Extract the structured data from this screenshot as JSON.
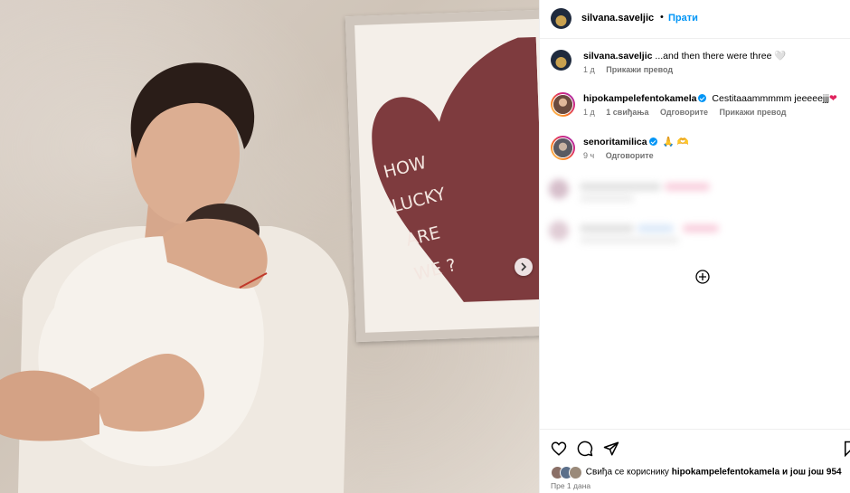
{
  "post": {
    "username": "silvana.saveljic",
    "separator": "•",
    "follow_label": "Прати"
  },
  "photo": {
    "sign_text": [
      "HOW",
      "LUCKY",
      "ARE",
      "WE ?"
    ],
    "colors": {
      "heart": "#7e3b3e",
      "frame": "#cfc6bd",
      "shirt": "#f2ede6"
    }
  },
  "comments": [
    {
      "username": "silvana.saveljic",
      "text": "...and then there were three",
      "emoji": "🤍",
      "time": "1 д",
      "actions": [
        "Прикажи превод"
      ]
    },
    {
      "username": "hipokampelefentokamela",
      "verified": true,
      "text": "Cestitaaammmmm jeeeeejjj",
      "emoji": "❤",
      "time": "1 д",
      "likes": "1 свиђања",
      "actions": [
        "Одговорите",
        "Прикажи превод"
      ]
    },
    {
      "username": "senoritamilica",
      "verified": true,
      "text": "",
      "emoji": "🙏 🫶",
      "time": "9 ч",
      "actions": [
        "Одговорите"
      ]
    }
  ],
  "likes": {
    "prefix": "Свиђа се кориснику",
    "user": "hipokampelefentokamela",
    "suffix": "и још још 954"
  },
  "date": "Пре 1 дана",
  "colors": {
    "accent": "#0095f6",
    "muted": "#737373"
  }
}
